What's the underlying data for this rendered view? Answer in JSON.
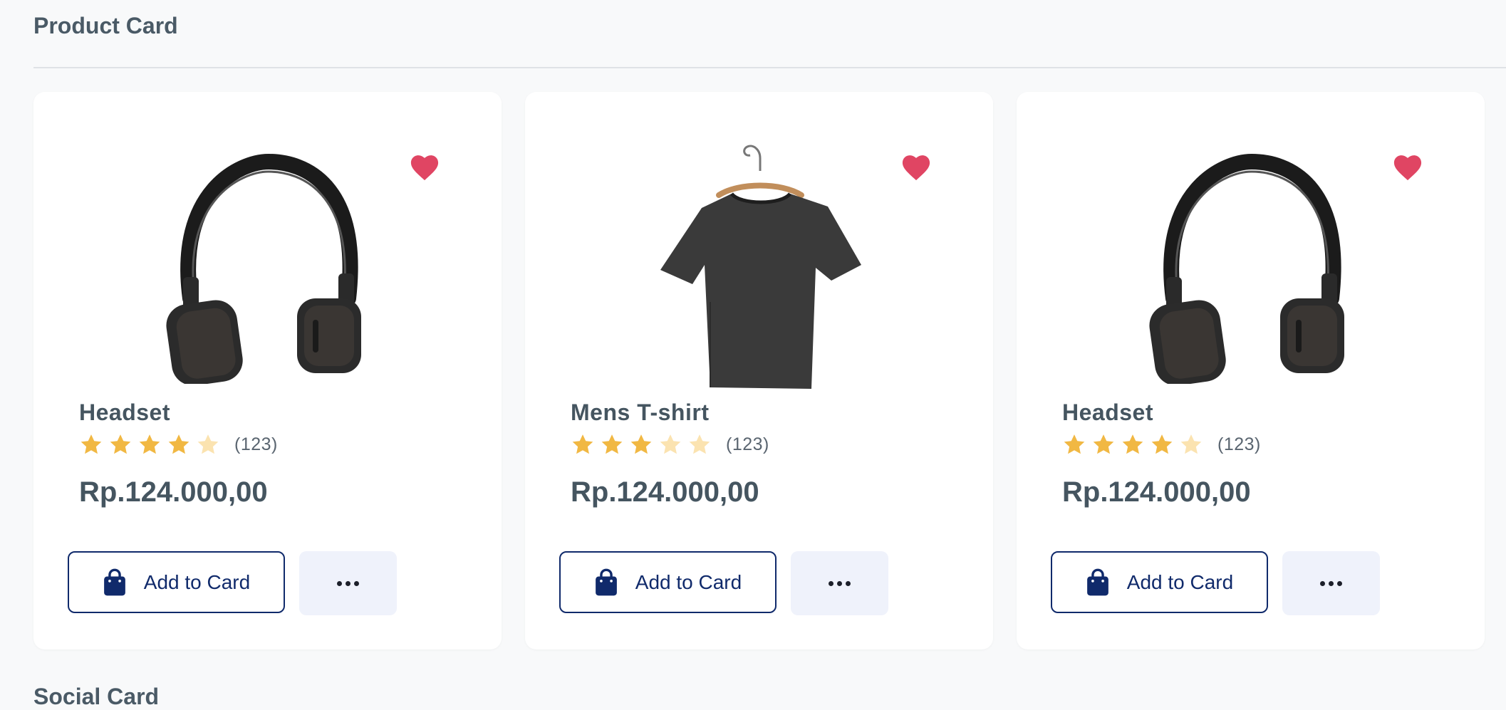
{
  "section": {
    "title": "Product Card",
    "next_title": "Social Card"
  },
  "colors": {
    "accent": "#102a6b",
    "favorite": "#e04563",
    "star": "#f1b843",
    "star_empty": "#fbe3b0"
  },
  "products": [
    {
      "name": "Headset",
      "image": "headset-image",
      "rating": 4,
      "rating_max": 5,
      "rating_count": "(123)",
      "price": "Rp.124.000,00",
      "add_label": "Add to Card",
      "favorite": true
    },
    {
      "name": "Mens T-shirt",
      "image": "tshirt-image",
      "rating": 3,
      "rating_max": 5,
      "rating_count": "(123)",
      "price": "Rp.124.000,00",
      "add_label": "Add to Card",
      "favorite": true
    },
    {
      "name": "Headset",
      "image": "headset-image",
      "rating": 4,
      "rating_max": 5,
      "rating_count": "(123)",
      "price": "Rp.124.000,00",
      "add_label": "Add to Card",
      "favorite": true
    }
  ]
}
